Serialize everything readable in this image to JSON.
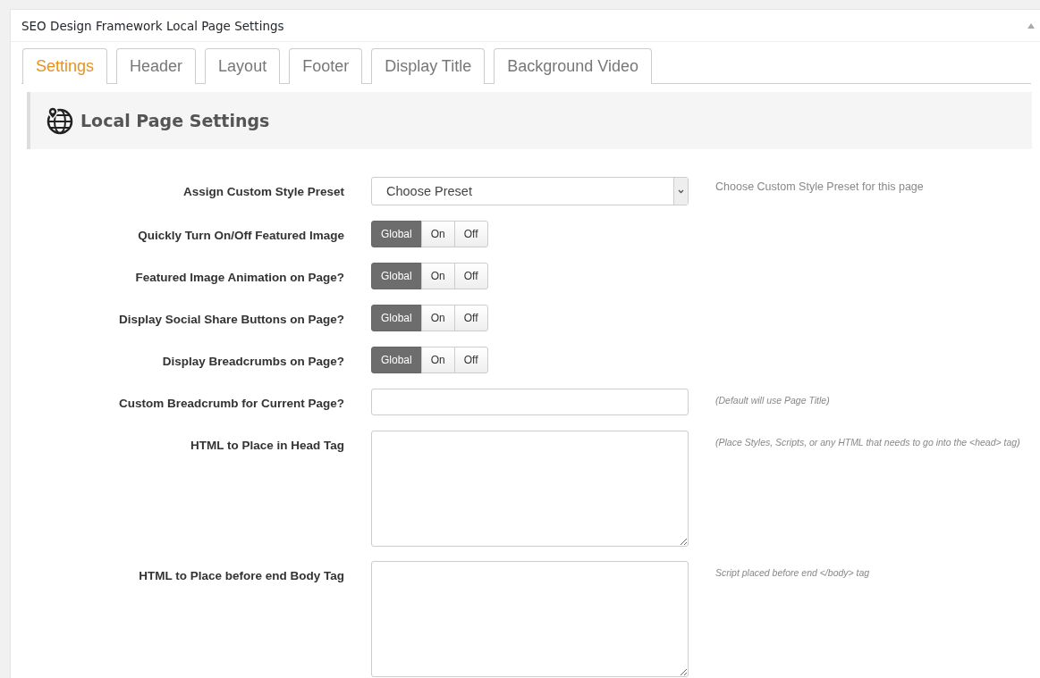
{
  "panel": {
    "title": "SEO Design Framework Local Page Settings"
  },
  "tabs": [
    {
      "label": "Settings",
      "selected": true
    },
    {
      "label": "Header",
      "selected": false
    },
    {
      "label": "Layout",
      "selected": false
    },
    {
      "label": "Footer",
      "selected": false
    },
    {
      "label": "Display Title",
      "selected": false
    },
    {
      "label": "Background Video",
      "selected": false
    }
  ],
  "section": {
    "title": "Local Page Settings"
  },
  "fields": [
    {
      "kind": "select",
      "label": "Assign Custom Style Preset",
      "value": "Choose Preset",
      "help": "Choose Custom Style Preset for this page"
    },
    {
      "kind": "toggle",
      "label": "Quickly Turn On/Off Featured Image",
      "options": [
        {
          "label": "Global",
          "selected": true
        },
        {
          "label": "On",
          "selected": false
        },
        {
          "label": "Off",
          "selected": false
        }
      ]
    },
    {
      "kind": "toggle",
      "label": "Featured Image Animation on Page?",
      "options": [
        {
          "label": "Global",
          "selected": true
        },
        {
          "label": "On",
          "selected": false
        },
        {
          "label": "Off",
          "selected": false
        }
      ]
    },
    {
      "kind": "toggle",
      "label": "Display Social Share Buttons on Page?",
      "options": [
        {
          "label": "Global",
          "selected": true
        },
        {
          "label": "On",
          "selected": false
        },
        {
          "label": "Off",
          "selected": false
        }
      ]
    },
    {
      "kind": "toggle",
      "label": "Display Breadcrumbs on Page?",
      "options": [
        {
          "label": "Global",
          "selected": true
        },
        {
          "label": "On",
          "selected": false
        },
        {
          "label": "Off",
          "selected": false
        }
      ]
    },
    {
      "kind": "text",
      "label": "Custom Breadcrumb for Current Page?",
      "help": "(Default will use Page Title)"
    },
    {
      "kind": "textarea",
      "label": "HTML to Place in Head Tag",
      "help": "(Place Styles, Scripts, or any HTML that needs to go into the <head> tag)"
    },
    {
      "kind": "textarea",
      "label": "HTML to Place before end Body Tag",
      "help": "Script placed before end </body> tag"
    }
  ]
}
